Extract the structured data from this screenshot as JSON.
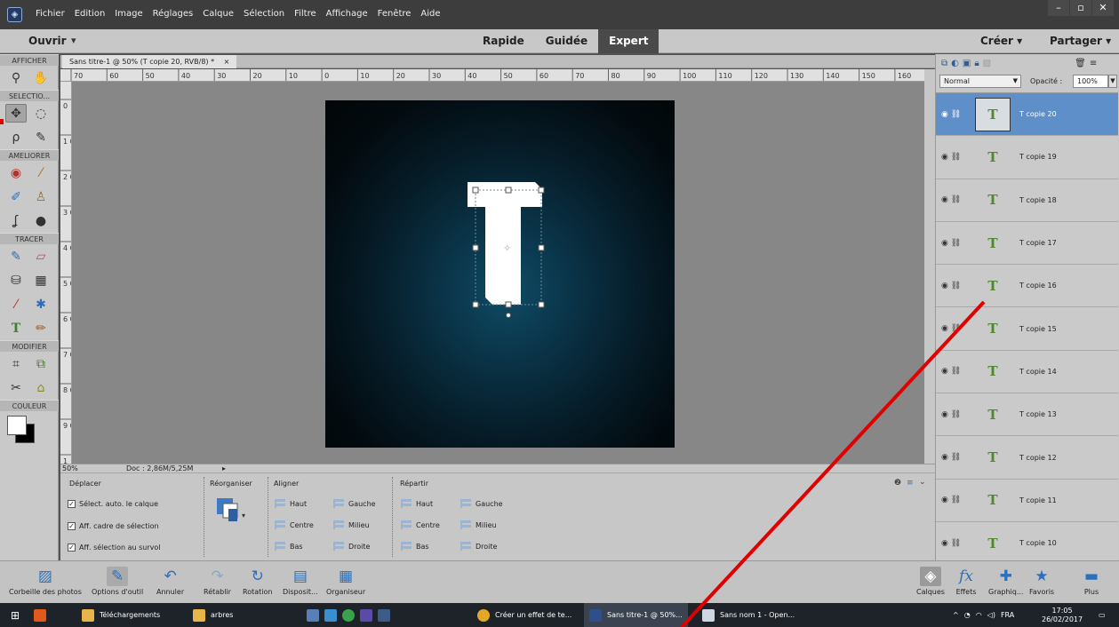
{
  "menubar": {
    "items": [
      "Fichier",
      "Edition",
      "Image",
      "Réglages",
      "Calque",
      "Sélection",
      "Filtre",
      "Affichage",
      "Fenêtre",
      "Aide"
    ],
    "window_controls": [
      "–",
      "▫",
      "✕"
    ]
  },
  "modebar": {
    "open_label": "Ouvrir",
    "modes": [
      "Rapide",
      "Guidée",
      "Expert"
    ],
    "active_mode": "Expert",
    "create_label": "Créer",
    "share_label": "Partager"
  },
  "toolbox": {
    "sections": {
      "view": "AFFICHER",
      "select": "SELECTIO...",
      "enhance": "AMELIORER",
      "draw": "TRACER",
      "modify": "MODIFIER",
      "color": "COULEUR"
    }
  },
  "document": {
    "tab_title": "Sans titre-1 @ 50% (T copie 20, RVB/8) *",
    "ruler_h": [
      "70",
      "60",
      "50",
      "40",
      "30",
      "20",
      "10",
      "0",
      "10",
      "20",
      "30",
      "40",
      "50",
      "60",
      "70",
      "80",
      "90",
      "100",
      "110",
      "120",
      "130",
      "140",
      "150",
      "160"
    ],
    "ruler_v": [
      "0",
      "1 0",
      "2 0",
      "3 0",
      "4 0",
      "5 0",
      "6 0",
      "7 0",
      "8 0",
      "9 0",
      "1"
    ],
    "zoom": "50%",
    "doc_size": "Doc : 2,86M/5,25M"
  },
  "tool_options": {
    "move_heading": "Déplacer",
    "auto_select": "Sélect. auto. le calque",
    "show_bbox": "Aff. cadre de sélection",
    "show_hover": "Aff. sélection au survol",
    "arrange_heading": "Réorganiser",
    "align_heading": "Aligner",
    "distribute_heading": "Répartir",
    "align_items": [
      "Haut",
      "Gauche",
      "Centre",
      "Milieu",
      "Bas",
      "Droite"
    ],
    "distribute_items": [
      "Haut",
      "Gauche",
      "Centre",
      "Milieu",
      "Bas",
      "Droite"
    ]
  },
  "layers_panel": {
    "blend_mode": "Normal",
    "opacity_label": "Opacité :",
    "opacity_value": "100%",
    "layers": [
      {
        "name": "T copie 20",
        "selected": true
      },
      {
        "name": "T copie 19",
        "selected": false
      },
      {
        "name": "T copie 18",
        "selected": false
      },
      {
        "name": "T copie 17",
        "selected": false
      },
      {
        "name": "T copie 16",
        "selected": false
      },
      {
        "name": "T copie 15",
        "selected": false
      },
      {
        "name": "T copie 14",
        "selected": false
      },
      {
        "name": "T copie 13",
        "selected": false
      },
      {
        "name": "T copie 12",
        "selected": false
      },
      {
        "name": "T copie 11",
        "selected": false
      },
      {
        "name": "T copie 10",
        "selected": false
      }
    ],
    "layer_thumb_glyph": "T"
  },
  "bottombar": {
    "items": [
      "Corbeille des photos",
      "Options d'outil",
      "Annuler",
      "Rétablir",
      "Rotation",
      "Disposit...",
      "Organiseur"
    ],
    "right_items": [
      "Calques",
      "Effets",
      "Graphiq...",
      "Favoris",
      "Plus"
    ]
  },
  "taskbar": {
    "items": [
      "Téléchargements",
      "arbres",
      "Créer un effet de te...",
      "Sans titre-1 @ 50%...",
      "Sans nom 1 - Open..."
    ],
    "lang": "FRA",
    "time": "17:05",
    "date": "26/02/2017"
  },
  "colors": {
    "selected_layer": "#5f8fc8",
    "annotation": "#e00000"
  }
}
